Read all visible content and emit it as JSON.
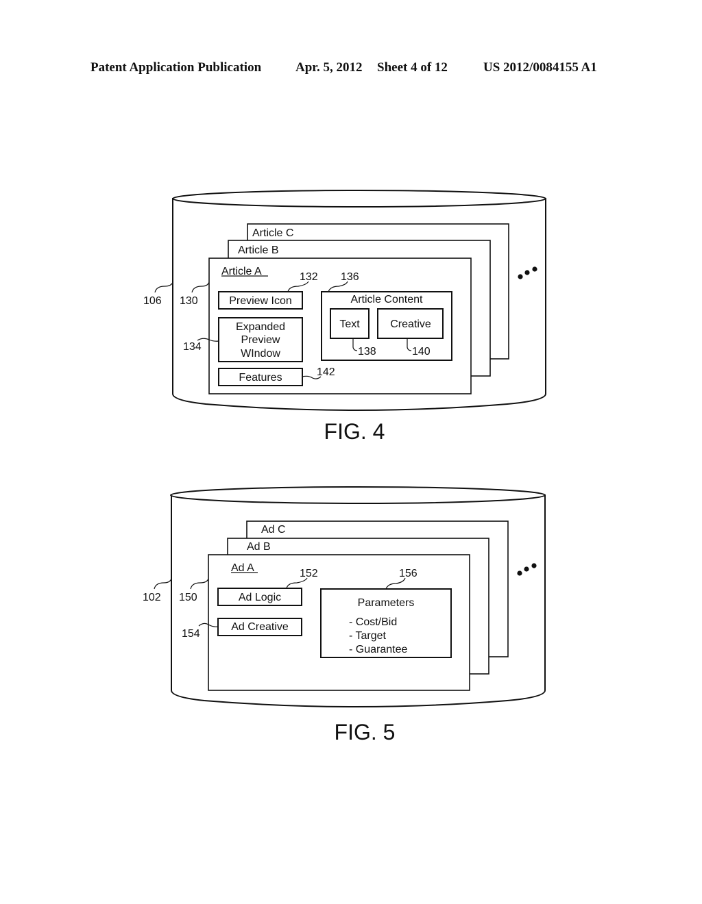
{
  "header": {
    "publication_type": "Patent Application Publication",
    "date": "Apr. 5, 2012",
    "sheet": "Sheet 4 of 12",
    "patent_number": "US 2012/0084155 A1"
  },
  "fig4": {
    "caption": "FIG. 4",
    "database_ref": "106",
    "articles": [
      {
        "title": "Article C"
      },
      {
        "title": "Article B"
      },
      {
        "title": "Article A",
        "ref": "130"
      }
    ],
    "preview_icon": {
      "label": "Preview Icon",
      "ref": "132"
    },
    "expanded_preview": {
      "lines": [
        "Expanded",
        "Preview",
        "WIndow"
      ],
      "ref": "134"
    },
    "features": {
      "label": "Features",
      "ref": "142"
    },
    "article_content": {
      "label": "Article Content",
      "ref": "136",
      "text": {
        "label": "Text",
        "ref": "138"
      },
      "creative": {
        "label": "Creative",
        "ref": "140"
      }
    },
    "ellipsis_icon": "more-dots"
  },
  "fig5": {
    "caption": "FIG. 5",
    "database_ref": "102",
    "ads": [
      {
        "title": "Ad C"
      },
      {
        "title": "Ad B"
      },
      {
        "title": "Ad A",
        "ref": "150"
      }
    ],
    "ad_logic": {
      "label": "Ad Logic",
      "ref": "152"
    },
    "ad_creative": {
      "label": "Ad Creative",
      "ref": "154"
    },
    "parameters": {
      "title": "Parameters",
      "ref": "156",
      "items": [
        "- Cost/Bid",
        "- Target",
        "- Guarantee"
      ]
    },
    "ellipsis_icon": "more-dots"
  }
}
